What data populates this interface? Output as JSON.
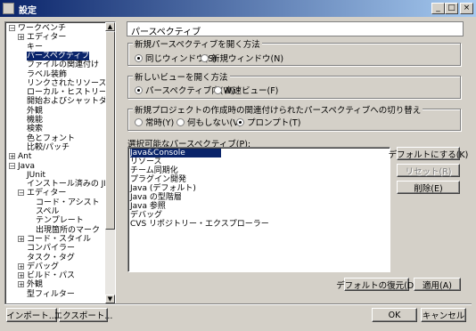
{
  "window": {
    "title": "設定",
    "minimize": "_",
    "maximize": "□",
    "close": "×"
  },
  "tree": {
    "items": [
      {
        "label": "ワークベンチ",
        "indent": 0,
        "exp": "-"
      },
      {
        "label": "エディター",
        "indent": 1,
        "exp": "+"
      },
      {
        "label": "キー",
        "indent": 1,
        "exp": ""
      },
      {
        "label": "パースペクティブ",
        "indent": 1,
        "exp": "",
        "selected": true
      },
      {
        "label": "ファイルの関連付け",
        "indent": 1,
        "exp": ""
      },
      {
        "label": "ラベル装飾",
        "indent": 1,
        "exp": ""
      },
      {
        "label": "リンクされたリソース",
        "indent": 1,
        "exp": ""
      },
      {
        "label": "ローカル・ヒストリー",
        "indent": 1,
        "exp": ""
      },
      {
        "label": "開始およびシャットダウン",
        "indent": 1,
        "exp": ""
      },
      {
        "label": "外観",
        "indent": 1,
        "exp": ""
      },
      {
        "label": "機能",
        "indent": 1,
        "exp": ""
      },
      {
        "label": "検索",
        "indent": 1,
        "exp": ""
      },
      {
        "label": "色とフォント",
        "indent": 1,
        "exp": ""
      },
      {
        "label": "比較/パッチ",
        "indent": 1,
        "exp": ""
      },
      {
        "label": "Ant",
        "indent": 0,
        "exp": "+"
      },
      {
        "label": "Java",
        "indent": 0,
        "exp": "-"
      },
      {
        "label": "JUnit",
        "indent": 1,
        "exp": ""
      },
      {
        "label": "インストール済みの JRE",
        "indent": 1,
        "exp": ""
      },
      {
        "label": "エディター",
        "indent": 1,
        "exp": "-"
      },
      {
        "label": "コード・アシスト",
        "indent": 2,
        "exp": ""
      },
      {
        "label": "スペル",
        "indent": 2,
        "exp": ""
      },
      {
        "label": "テンプレート",
        "indent": 2,
        "exp": ""
      },
      {
        "label": "出現箇所のマーク",
        "indent": 2,
        "exp": ""
      },
      {
        "label": "コード・スタイル",
        "indent": 1,
        "exp": "+"
      },
      {
        "label": "コンパイラー",
        "indent": 1,
        "exp": ""
      },
      {
        "label": "タスク・タグ",
        "indent": 1,
        "exp": ""
      },
      {
        "label": "デバッグ",
        "indent": 1,
        "exp": "+"
      },
      {
        "label": "ビルド・パス",
        "indent": 1,
        "exp": "+"
      },
      {
        "label": "外観",
        "indent": 1,
        "exp": "+"
      },
      {
        "label": "型フィルター",
        "indent": 1,
        "exp": ""
      }
    ]
  },
  "page": {
    "title": "パースペクティブ"
  },
  "group_open": {
    "title": "新規パースペクティブを開く方法",
    "options": [
      {
        "label": "同じウィンドウ(S)",
        "checked": true
      },
      {
        "label": "新規ウィンドウ(N)",
        "checked": false
      }
    ]
  },
  "group_view": {
    "title": "新しいビューを開く方法",
    "options": [
      {
        "label": "パースペクティブ内(W)",
        "checked": true
      },
      {
        "label": "高速ビュー(F)",
        "checked": false
      }
    ]
  },
  "group_project": {
    "title": "新規プロジェクトの作成時の関連付けられたパースペクティブへの切り替え",
    "options": [
      {
        "label": "常時(Y)",
        "checked": false
      },
      {
        "label": "何もしない(V)",
        "checked": false
      },
      {
        "label": "プロンプト(T)",
        "checked": true
      }
    ]
  },
  "list": {
    "label": "選択可能なパースペクティブ(P):",
    "items": [
      {
        "label": "Java&Console",
        "selected": true
      },
      {
        "label": "リソース"
      },
      {
        "label": "チーム同期化"
      },
      {
        "label": "プラグイン開発"
      },
      {
        "label": "Java (デフォルト)"
      },
      {
        "label": "Java の型階層"
      },
      {
        "label": "Java 参照"
      },
      {
        "label": "デバッグ"
      },
      {
        "label": "CVS リポジトリー・エクスプローラー"
      }
    ]
  },
  "buttons": {
    "make_default": "デフォルトにする(K)",
    "reset": "リセット(R)",
    "delete": "削除(E)",
    "restore_defaults": "デフォルトの復元(D)",
    "apply": "適用(A)",
    "import": "インポート...",
    "export": "エクスポート...",
    "ok": "OK",
    "cancel": "キャンセル"
  }
}
